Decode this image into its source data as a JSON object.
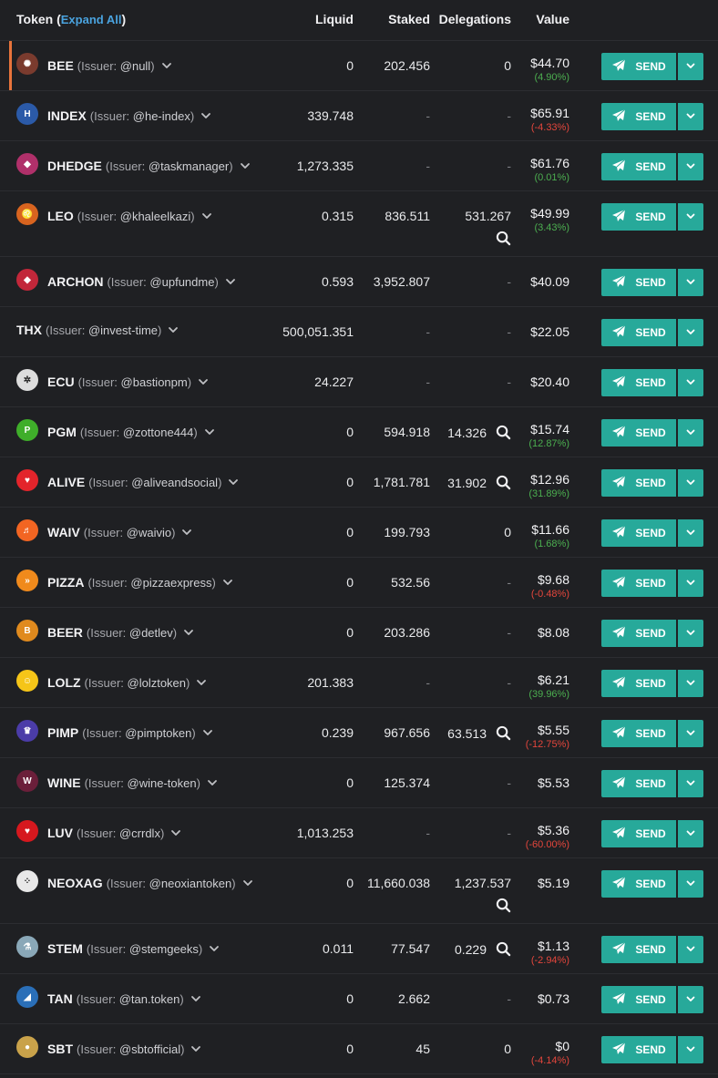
{
  "header": {
    "token": "Token",
    "paren_open": "(",
    "expand_all": "Expand All",
    "paren_close": ")",
    "liquid": "Liquid",
    "staked": "Staked",
    "delegations": "Delegations",
    "value": "Value"
  },
  "send_label": "SEND",
  "issuer_prefix": "(Issuer: ",
  "issuer_suffix": ")",
  "rows": [
    {
      "symbol": "BEE",
      "issuer": "@null",
      "liquid": "0",
      "staked": "202.456",
      "delegations": "0",
      "value": "$44.70",
      "change": "(4.90%)",
      "change_dir": "pos",
      "icon": "bee-token-icon",
      "icon_color": "#7a3b2e"
    },
    {
      "symbol": "INDEX",
      "issuer": "@he-index",
      "liquid": "339.748",
      "staked": "-",
      "delegations": "-",
      "value": "$65.91",
      "change": "(-4.33%)",
      "change_dir": "neg",
      "icon": "index-token-icon",
      "icon_color": "#2b5aa8"
    },
    {
      "symbol": "DHEDGE",
      "issuer": "@taskmanager",
      "liquid": "1,273.335",
      "staked": "-",
      "delegations": "-",
      "value": "$61.76",
      "change": "(0.01%)",
      "change_dir": "pos",
      "icon": "dhedge-token-icon",
      "icon_color": "#b0306a"
    },
    {
      "symbol": "LEO",
      "issuer": "@khaleelkazi",
      "liquid": "0.315",
      "staked": "836.511",
      "delegations": "531.267",
      "value": "$49.99",
      "change": "(3.43%)",
      "change_dir": "pos",
      "icon": "leo-token-icon",
      "icon_color": "#d8641f"
    },
    {
      "symbol": "ARCHON",
      "issuer": "@upfundme",
      "liquid": "0.593",
      "staked": "3,952.807",
      "delegations": "-",
      "value": "$40.09",
      "change": "",
      "change_dir": "",
      "icon": "archon-token-icon",
      "icon_color": "#c2273a"
    },
    {
      "symbol": "THX",
      "issuer": "@invest-time",
      "liquid": "500,051.351",
      "staked": "-",
      "delegations": "-",
      "value": "$22.05",
      "change": "",
      "change_dir": "",
      "icon": "",
      "icon_color": ""
    },
    {
      "symbol": "ECU",
      "issuer": "@bastionpm",
      "liquid": "24.227",
      "staked": "-",
      "delegations": "-",
      "value": "$20.40",
      "change": "",
      "change_dir": "",
      "icon": "ecu-token-icon",
      "icon_color": "#dddddd"
    },
    {
      "symbol": "PGM",
      "issuer": "@zottone444",
      "liquid": "0",
      "staked": "594.918",
      "delegations": "14.326",
      "value": "$15.74",
      "change": "(12.87%)",
      "change_dir": "pos",
      "icon": "pgm-token-icon",
      "icon_color": "#3fae2a"
    },
    {
      "symbol": "ALIVE",
      "issuer": "@aliveandsocial",
      "liquid": "0",
      "staked": "1,781.781",
      "delegations": "31.902",
      "value": "$12.96",
      "change": "(31.89%)",
      "change_dir": "pos",
      "icon": "alive-token-icon",
      "icon_color": "#e3242b"
    },
    {
      "symbol": "WAIV",
      "issuer": "@waivio",
      "liquid": "0",
      "staked": "199.793",
      "delegations": "0",
      "value": "$11.66",
      "change": "(1.68%)",
      "change_dir": "pos",
      "icon": "waiv-token-icon",
      "icon_color": "#f26522"
    },
    {
      "symbol": "PIZZA",
      "issuer": "@pizzaexpress",
      "liquid": "0",
      "staked": "532.56",
      "delegations": "-",
      "value": "$9.68",
      "change": "(-0.48%)",
      "change_dir": "neg",
      "icon": "pizza-token-icon",
      "icon_color": "#f08a1c"
    },
    {
      "symbol": "BEER",
      "issuer": "@detlev",
      "liquid": "0",
      "staked": "203.286",
      "delegations": "-",
      "value": "$8.08",
      "change": "",
      "change_dir": "",
      "icon": "beer-token-icon",
      "icon_color": "#e08a1e"
    },
    {
      "symbol": "LOLZ",
      "issuer": "@lolztoken",
      "liquid": "201.383",
      "staked": "-",
      "delegations": "-",
      "value": "$6.21",
      "change": "(39.96%)",
      "change_dir": "pos",
      "icon": "lolz-token-icon",
      "icon_color": "#f5c518"
    },
    {
      "symbol": "PIMP",
      "issuer": "@pimptoken",
      "liquid": "0.239",
      "staked": "967.656",
      "delegations": "63.513",
      "value": "$5.55",
      "change": "(-12.75%)",
      "change_dir": "neg",
      "icon": "pimp-token-icon",
      "icon_color": "#4b3ca8"
    },
    {
      "symbol": "WINE",
      "issuer": "@wine-token",
      "liquid": "0",
      "staked": "125.374",
      "delegations": "-",
      "value": "$5.53",
      "change": "",
      "change_dir": "",
      "icon": "wine-token-icon",
      "icon_color": "#6b1f3a"
    },
    {
      "symbol": "LUV",
      "issuer": "@crrdlx",
      "liquid": "1,013.253",
      "staked": "-",
      "delegations": "-",
      "value": "$5.36",
      "change": "(-60.00%)",
      "change_dir": "neg",
      "icon": "luv-token-icon",
      "icon_color": "#d6181e"
    },
    {
      "symbol": "NEOXAG",
      "issuer": "@neoxiantoken",
      "liquid": "0",
      "staked": "11,660.038",
      "delegations": "1,237.537",
      "value": "$5.19",
      "change": "",
      "change_dir": "",
      "icon": "neoxag-token-icon",
      "icon_color": "#e8e8e8"
    },
    {
      "symbol": "STEM",
      "issuer": "@stemgeeks",
      "liquid": "0.011",
      "staked": "77.547",
      "delegations": "0.229",
      "value": "$1.13",
      "change": "(-2.94%)",
      "change_dir": "neg",
      "icon": "stem-token-icon",
      "icon_color": "#8aa8b8"
    },
    {
      "symbol": "TAN",
      "issuer": "@tan.token",
      "liquid": "0",
      "staked": "2.662",
      "delegations": "-",
      "value": "$0.73",
      "change": "",
      "change_dir": "",
      "icon": "tan-token-icon",
      "icon_color": "#2a6fb8"
    },
    {
      "symbol": "SBT",
      "issuer": "@sbtofficial",
      "liquid": "0",
      "staked": "45",
      "delegations": "0",
      "value": "$0",
      "change": "(-4.14%)",
      "change_dir": "neg",
      "icon": "sbt-token-icon",
      "icon_color": "#c9a24a"
    }
  ]
}
